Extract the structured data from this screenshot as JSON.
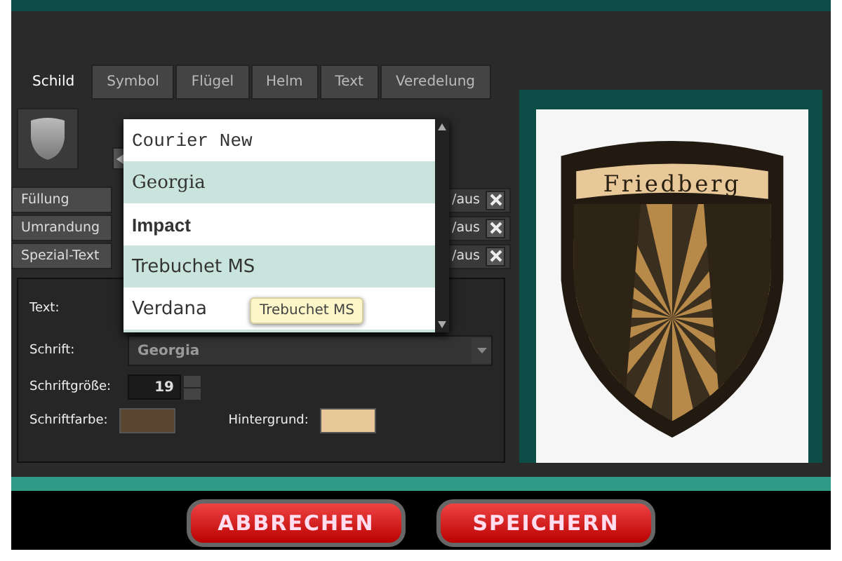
{
  "tabs": [
    {
      "label": "Schild",
      "selected": true
    },
    {
      "label": "Symbol",
      "selected": false
    },
    {
      "label": "Flügel",
      "selected": false
    },
    {
      "label": "Helm",
      "selected": false
    },
    {
      "label": "Text",
      "selected": false
    },
    {
      "label": "Veredelung",
      "selected": false
    }
  ],
  "layers": [
    {
      "label": "Füllung",
      "toggle": "/aus"
    },
    {
      "label": "Umrandung",
      "toggle": "/aus"
    },
    {
      "label": "Spezial-Text",
      "toggle": "/aus"
    }
  ],
  "font_dropdown": {
    "options": [
      {
        "label": "Courier New",
        "kind": "mono"
      },
      {
        "label": "Georgia",
        "kind": "serif"
      },
      {
        "label": "Impact",
        "kind": "bold"
      },
      {
        "label": "Trebuchet MS",
        "kind": "sans"
      },
      {
        "label": "Verdana",
        "kind": "sans"
      }
    ],
    "tooltip": "Trebuchet MS"
  },
  "form": {
    "text_label": "Text:",
    "font_label": "Schrift:",
    "font_value": "Georgia",
    "size_label": "Schriftgröße:",
    "size_value": "19"
  },
  "swatches": [
    {
      "label": "Schriftfarbe:",
      "color": "#5a4630"
    },
    {
      "label": "Hintergrund:",
      "color": "#e8c898"
    }
  ],
  "preview": {
    "banner": "Friedberg"
  },
  "buttons": [
    "ABBRECHEN",
    "SPEICHERN"
  ]
}
